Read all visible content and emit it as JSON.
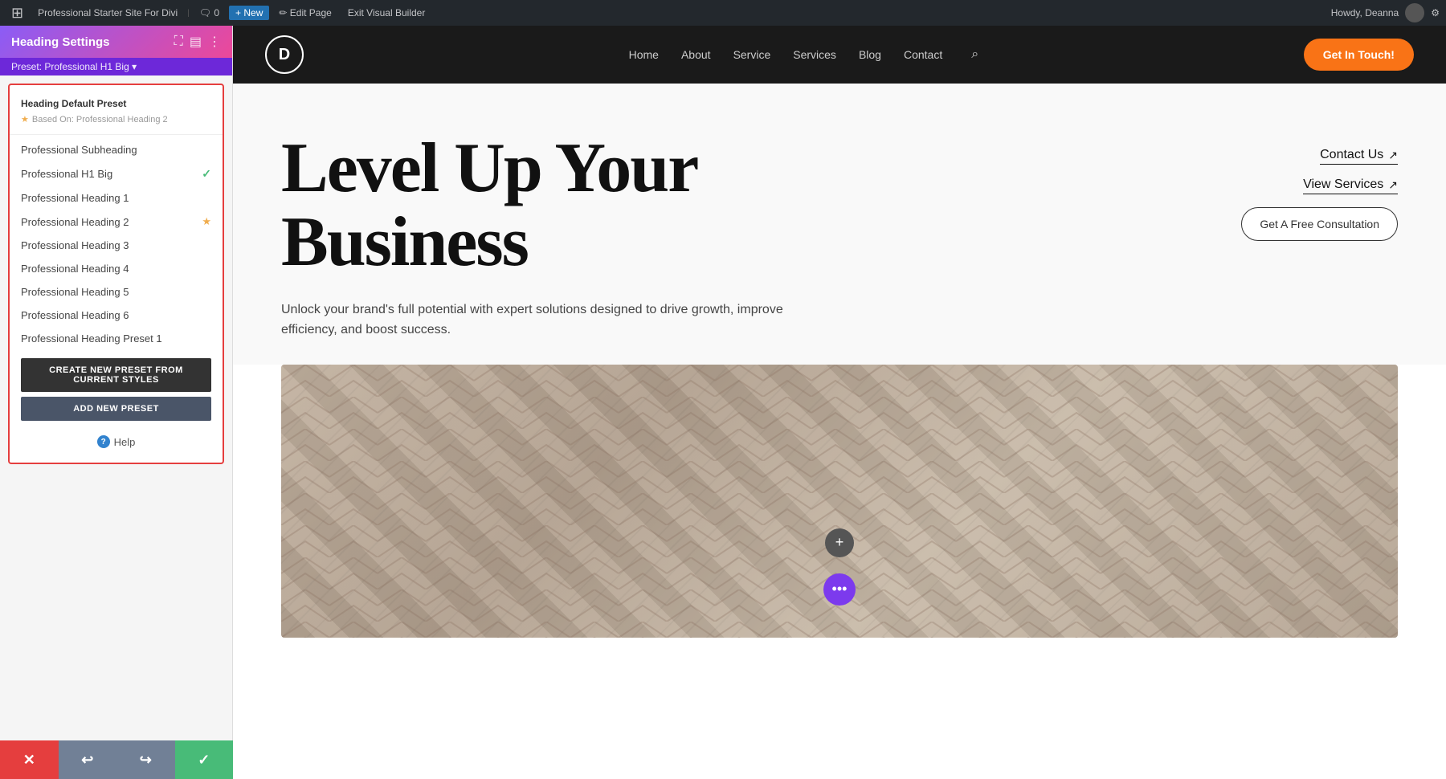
{
  "adminBar": {
    "logo": "⊞",
    "items": [
      {
        "label": "Professional Starter Site For Divi",
        "type": "site"
      },
      {
        "label": "0",
        "type": "comments"
      },
      {
        "label": "+ New",
        "type": "new"
      },
      {
        "label": "Edit Page",
        "type": "edit"
      },
      {
        "label": "Exit Visual Builder",
        "type": "exit"
      }
    ],
    "right": {
      "greeting": "Howdy, Deanna"
    }
  },
  "panel": {
    "title": "Heading Settings",
    "presetBar": "Preset: Professional H1 Big ▾",
    "sectionHeader": "Heading Default Preset",
    "basedOn": "Based On: Professional Heading 2",
    "presets": [
      {
        "label": "Professional Subheading",
        "active": false,
        "starred": false
      },
      {
        "label": "Professional H1 Big",
        "active": true,
        "starred": false
      },
      {
        "label": "Professional Heading 1",
        "active": false,
        "starred": false
      },
      {
        "label": "Professional Heading 2",
        "active": false,
        "starred": true
      },
      {
        "label": "Professional Heading 3",
        "active": false,
        "starred": false
      },
      {
        "label": "Professional Heading 4",
        "active": false,
        "starred": false
      },
      {
        "label": "Professional Heading 5",
        "active": false,
        "starred": false
      },
      {
        "label": "Professional Heading 6",
        "active": false,
        "starred": false
      },
      {
        "label": "Professional Heading Preset 1",
        "active": false,
        "starred": false
      }
    ],
    "createButton": "CREATE NEW PRESET FROM CURRENT STYLES",
    "addButton": "ADD NEW PRESET",
    "help": "Help"
  },
  "bottomBar": {
    "close": "✕",
    "undo": "↩",
    "redo": "↪",
    "save": "✓"
  },
  "siteNav": {
    "logo": "D",
    "links": [
      "Home",
      "About",
      "Service",
      "Services",
      "Blog",
      "Contact"
    ],
    "cta": "Get In Touch!"
  },
  "hero": {
    "title": "Level Up Your Business",
    "description": "Unlock your brand's full potential with expert solutions designed to drive growth, improve efficiency, and boost success.",
    "links": [
      {
        "label": "Contact Us",
        "arrow": "↗"
      },
      {
        "label": "View Services",
        "arrow": "↗"
      }
    ],
    "cta": "Get A Free Consultation"
  },
  "addButton": "+",
  "moreButton": "•••",
  "colors": {
    "panelGradientStart": "#8b5cf6",
    "panelGradientEnd": "#ec4899",
    "navBg": "#1a1a1a",
    "ctaOrange": "#f97316",
    "errorRed": "#e53e3e",
    "saveGreen": "#48bb78",
    "purpleMore": "#7c3aed"
  }
}
